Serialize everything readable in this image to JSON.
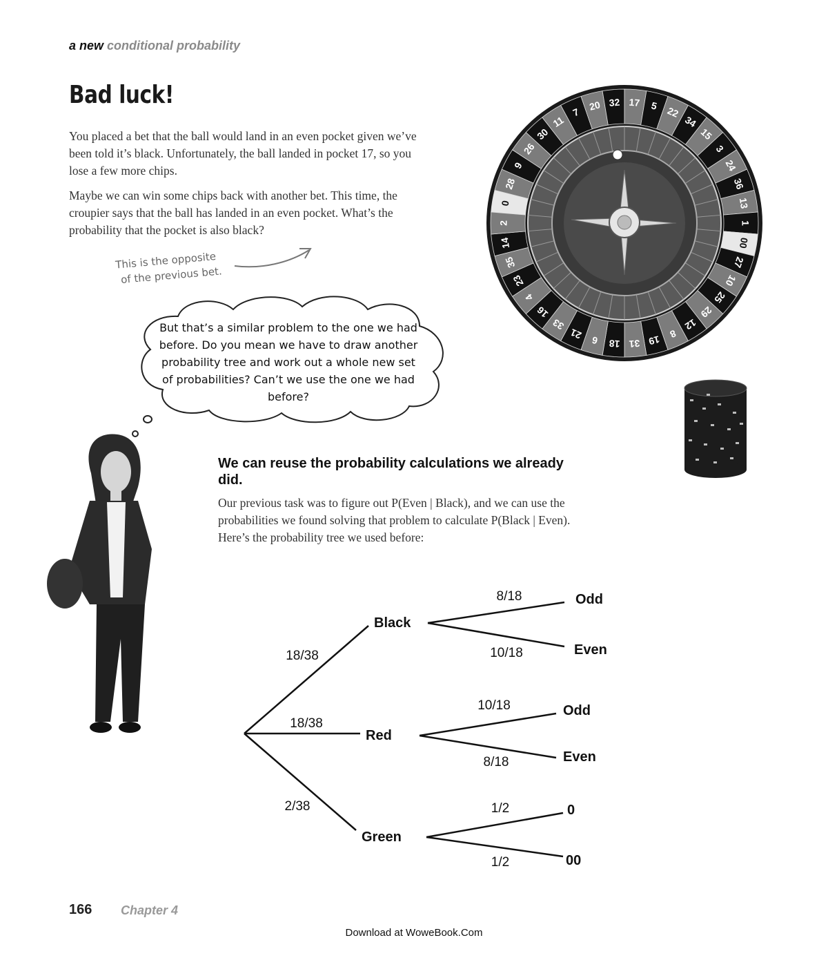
{
  "header": {
    "running_head_bold": "a new",
    "running_head_light": "conditional probability"
  },
  "title": "Bad luck!",
  "paragraphs": {
    "p1": "You placed a bet that the ball would land in an even pocket given we’ve been told it’s black. Unfortunately, the ball landed in pocket 17, so you lose a few more chips.",
    "p2": "Maybe we can win some chips back with another bet. This time, the croupier says that the ball has landed in an even pocket. What’s the probability that the pocket is also black?"
  },
  "annotation": {
    "line1": "This is the opposite",
    "line2": "of the previous bet."
  },
  "thought_bubble": "But that’s a similar problem to the one we had before. Do you mean we have to draw another probability tree and work out a whole new set of probabilities? Can’t we use the one we had before?",
  "section": {
    "heading": "We can reuse the probability calculations we already did.",
    "body": "Our previous task was to figure out P(Even | Black), and we can use the probabilities we found solving that problem to calculate P(Black | Even). Here’s the probability tree we used before:"
  },
  "roulette": {
    "pockets": [
      "0",
      "28",
      "9",
      "26",
      "30",
      "11",
      "7",
      "20",
      "32",
      "17",
      "5",
      "22",
      "34",
      "15",
      "3",
      "24",
      "36",
      "13",
      "1",
      "00",
      "27",
      "10",
      "25",
      "29",
      "12",
      "8",
      "19",
      "31",
      "18",
      "6",
      "21",
      "33",
      "16",
      "4",
      "23",
      "35",
      "14",
      "2"
    ],
    "colors": {
      "black": "#111111",
      "red": "#7c7c7c",
      "green": "#e8e8e8"
    }
  },
  "tree": {
    "branches": [
      {
        "label": "Black",
        "prob": "18/38",
        "children": [
          {
            "label": "Odd",
            "prob": "8/18"
          },
          {
            "label": "Even",
            "prob": "10/18"
          }
        ]
      },
      {
        "label": "Red",
        "prob": "18/38",
        "children": [
          {
            "label": "Odd",
            "prob": "10/18"
          },
          {
            "label": "Even",
            "prob": "8/18"
          }
        ]
      },
      {
        "label": "Green",
        "prob": "2/38",
        "children": [
          {
            "label": "0",
            "prob": "1/2"
          },
          {
            "label": "00",
            "prob": "1/2"
          }
        ]
      }
    ]
  },
  "footer": {
    "page_number": "166",
    "chapter": "Chapter 4",
    "download": "Download at WoweBook.Com"
  }
}
